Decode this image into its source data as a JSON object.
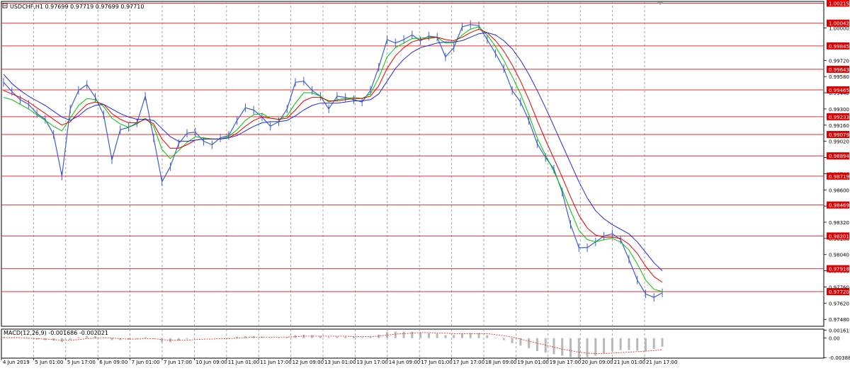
{
  "window": {
    "title": "USDCHF,H1  0.97699 0.97719 0.97699 0.97710",
    "symbol": "USDCHF",
    "timeframe": "H1",
    "ohlc": [
      0.97699,
      0.97719,
      0.97699,
      0.9771
    ]
  },
  "colors": {
    "background": "#ffffff",
    "price_line": "#3a5fcd",
    "ma_fast": "#00c000",
    "ma_mid": "#e00000",
    "ma_slow": "#1f2bd8",
    "level_line": "#e03030",
    "level_label_bg": "#e00000",
    "level_label_text": "#ffffff",
    "grid": "#8f8f8f",
    "axis_text": "#000000",
    "macd_hist": "#b8b8b8",
    "macd_signal": "#e03030"
  },
  "chart_data": [
    {
      "type": "line",
      "subtype": "candlestick-like price chart with moving averages and horizontal levels",
      "ylim": [
        0.9742,
        1.0023
      ],
      "y_ticks": [
        "1.00000",
        "0.99720",
        "0.99580",
        "0.99440",
        "0.99300",
        "0.99160",
        "0.99020",
        "0.98880",
        "0.98740",
        "0.98600",
        "0.98460",
        "0.98320",
        "0.98180",
        "0.98040",
        "0.97900",
        "0.97760",
        "0.97620",
        "0.97480"
      ],
      "levels": [
        "1.00215",
        "1.00042",
        "0.99845",
        "0.99643",
        "0.99465",
        "0.99233",
        "0.99079",
        "0.98894",
        "0.98719",
        "0.98469",
        "0.98201",
        "0.97918",
        "0.97720"
      ],
      "x_tick_labels": [
        "4 Jun 2019",
        "5 Jun 01:00",
        "5 Jun 17:00",
        "6 Jun 09:00",
        "7 Jun 01:00",
        "7 Jun 17:00",
        "10 Jun 09:00",
        "11 Jun 01:00",
        "11 Jun 17:00",
        "12 Jun 09:00",
        "13 Jun 01:00",
        "13 Jun 17:00",
        "14 Jun 09:00",
        "17 Jun 01:00",
        "17 Jun 17:00",
        "18 Jun 09:00",
        "19 Jun 01:00",
        "19 Jun 17:00",
        "20 Jun 09:00",
        "21 Jun 01:00",
        "21 Jun 17:00"
      ],
      "series": [
        {
          "kind": "price",
          "values": [
            0.9953,
            0.9945,
            0.9938,
            0.9934,
            0.9926,
            0.9921,
            0.9908,
            0.9872,
            0.993,
            0.9946,
            0.9951,
            0.994,
            0.9925,
            0.9886,
            0.9912,
            0.9914,
            0.9918,
            0.9941,
            0.9905,
            0.9867,
            0.988,
            0.99,
            0.9909,
            0.991,
            0.9902,
            0.9899,
            0.9905,
            0.9907,
            0.992,
            0.9931,
            0.9929,
            0.9923,
            0.9915,
            0.9919,
            0.993,
            0.9953,
            0.9954,
            0.9946,
            0.9941,
            0.993,
            0.9941,
            0.994,
            0.9938,
            0.9936,
            0.9946,
            0.9966,
            0.999,
            0.9987,
            0.999,
            0.9994,
            0.9989,
            0.9993,
            0.9992,
            0.9975,
            0.9983,
            1.0001,
            1.0003,
            1.0002,
            0.999,
            0.9978,
            0.9965,
            0.9946,
            0.9936,
            0.992,
            0.99,
            0.9888,
            0.9878,
            0.9858,
            0.983,
            0.981,
            0.981,
            0.9815,
            0.982,
            0.9822,
            0.9817,
            0.98,
            0.9782,
            0.977,
            0.9767,
            0.9771
          ]
        },
        {
          "kind": "ma_fast",
          "values": [
            0.994,
            0.9938,
            0.9934,
            0.993,
            0.9925,
            0.992,
            0.9915,
            0.9911,
            0.9922,
            0.9933,
            0.9939,
            0.9938,
            0.9932,
            0.9922,
            0.9917,
            0.9914,
            0.9917,
            0.9922,
            0.9915,
            0.9895,
            0.9887,
            0.9894,
            0.9901,
            0.9906,
            0.9905,
            0.9904,
            0.9904,
            0.9906,
            0.9912,
            0.992,
            0.9925,
            0.9926,
            0.9922,
            0.9921,
            0.9924,
            0.9935,
            0.9944,
            0.9944,
            0.9941,
            0.9936,
            0.9938,
            0.9939,
            0.994,
            0.9939,
            0.9943,
            0.9957,
            0.9975,
            0.9983,
            0.9987,
            0.9991,
            0.9991,
            0.9992,
            0.9992,
            0.9987,
            0.9987,
            0.9994,
            0.9999,
            1.0001,
            0.9994,
            0.9984,
            0.9972,
            0.9958,
            0.9943,
            0.9925,
            0.9905,
            0.989,
            0.9876,
            0.986,
            0.9842,
            0.9825,
            0.9817,
            0.9815,
            0.9817,
            0.9818,
            0.9815,
            0.9808,
            0.9796,
            0.9782,
            0.9774,
            0.9772
          ]
        },
        {
          "kind": "ma_mid",
          "values": [
            0.9946,
            0.9943,
            0.994,
            0.9936,
            0.9931,
            0.9926,
            0.9921,
            0.9916,
            0.9919,
            0.9927,
            0.9934,
            0.9936,
            0.9934,
            0.9926,
            0.9921,
            0.9918,
            0.9918,
            0.9921,
            0.9917,
            0.9904,
            0.9896,
            0.9896,
            0.9899,
            0.9903,
            0.9904,
            0.9904,
            0.9904,
            0.9905,
            0.9909,
            0.9915,
            0.992,
            0.9923,
            0.9922,
            0.9921,
            0.9922,
            0.9929,
            0.9937,
            0.994,
            0.994,
            0.9937,
            0.9937,
            0.9938,
            0.9939,
            0.9939,
            0.9941,
            0.995,
            0.9965,
            0.9976,
            0.9983,
            0.9988,
            0.999,
            0.9991,
            0.9992,
            0.999,
            0.9989,
            0.9992,
            0.9996,
            0.9999,
            0.9996,
            0.9989,
            0.998,
            0.9968,
            0.9954,
            0.9938,
            0.992,
            0.9903,
            0.9887,
            0.9871,
            0.9854,
            0.9838,
            0.9827,
            0.9821,
            0.9819,
            0.9819,
            0.9818,
            0.9813,
            0.9805,
            0.9794,
            0.9785,
            0.978
          ]
        },
        {
          "kind": "ma_slow",
          "values": [
            0.996,
            0.9952,
            0.9946,
            0.9941,
            0.9937,
            0.9933,
            0.9928,
            0.9923,
            0.992,
            0.9924,
            0.993,
            0.9933,
            0.9934,
            0.993,
            0.9926,
            0.9923,
            0.9921,
            0.9921,
            0.992,
            0.9913,
            0.9906,
            0.9902,
            0.9902,
            0.9903,
            0.9904,
            0.9904,
            0.9904,
            0.9905,
            0.9907,
            0.9911,
            0.9915,
            0.9918,
            0.9919,
            0.9919,
            0.992,
            0.9924,
            0.9929,
            0.9933,
            0.9935,
            0.9935,
            0.9935,
            0.9936,
            0.9937,
            0.9937,
            0.9938,
            0.9943,
            0.9954,
            0.9965,
            0.9973,
            0.9979,
            0.9983,
            0.9985,
            0.9987,
            0.9988,
            0.9988,
            0.9989,
            0.9992,
            0.9995,
            0.9996,
            0.9994,
            0.9989,
            0.9982,
            0.9972,
            0.996,
            0.9946,
            0.9931,
            0.9915,
            0.9899,
            0.9883,
            0.9867,
            0.9853,
            0.9842,
            0.9835,
            0.983,
            0.9826,
            0.9822,
            0.9815,
            0.9806,
            0.9797,
            0.979
          ]
        }
      ]
    },
    {
      "type": "bar",
      "title": "MACD(12,26,9) -0.001686 -0.002021",
      "indicator": "MACD",
      "params": [
        12,
        26,
        9
      ],
      "current_values": [
        -0.001686,
        -0.002021
      ],
      "ylim": [
        -0.004,
        0.0018
      ],
      "y_ticks": [
        "0.001615",
        "0.00",
        "-0.003887"
      ],
      "histogram": [
        0.0002,
        0.0001,
        0.0,
        -0.0001,
        -0.0003,
        -0.0004,
        -0.0005,
        -0.0008,
        -0.0003,
        0.0002,
        0.0004,
        0.0004,
        0.0001,
        -0.0004,
        -0.0004,
        -0.0003,
        -0.0002,
        0.0002,
        -0.0001,
        -0.0008,
        -0.0008,
        -0.0005,
        -0.0002,
        0.0,
        0.0,
        0.0,
        0.0,
        0.0001,
        0.0003,
        0.0004,
        0.0004,
        0.0003,
        0.0001,
        0.0001,
        0.0002,
        0.0006,
        0.0007,
        0.0006,
        0.0004,
        0.0002,
        0.0003,
        0.0003,
        0.0003,
        0.0002,
        0.0003,
        0.0007,
        0.0012,
        0.0013,
        0.0013,
        0.0013,
        0.0011,
        0.001,
        0.0009,
        0.0006,
        0.0006,
        0.0009,
        0.001,
        0.001,
        0.0006,
        0.0001,
        -0.0004,
        -0.001,
        -0.0015,
        -0.002,
        -0.0026,
        -0.0029,
        -0.0032,
        -0.0035,
        -0.0038,
        -0.0039,
        -0.0038,
        -0.0035,
        -0.003,
        -0.0026,
        -0.0024,
        -0.0024,
        -0.0025,
        -0.0025,
        -0.0022,
        -0.0017
      ],
      "signal": [
        0.0001,
        0.0001,
        0.0001,
        0.0,
        -0.0001,
        -0.0002,
        -0.0003,
        -0.0004,
        -0.0004,
        -0.0003,
        -0.0001,
        0.0,
        0.0001,
        0.0,
        -0.0001,
        -0.0002,
        -0.0002,
        -0.0001,
        -0.0001,
        -0.0003,
        -0.0004,
        -0.0004,
        -0.0004,
        -0.0003,
        -0.0002,
        -0.0002,
        -0.0001,
        -0.0001,
        0.0,
        0.0001,
        0.0002,
        0.0002,
        0.0002,
        0.0002,
        0.0002,
        0.0003,
        0.0004,
        0.0004,
        0.0004,
        0.0004,
        0.0004,
        0.0004,
        0.0003,
        0.0003,
        0.0003,
        0.0004,
        0.0006,
        0.0008,
        0.0009,
        0.001,
        0.0011,
        0.0011,
        0.001,
        0.001,
        0.0009,
        0.0009,
        0.0009,
        0.0009,
        0.0009,
        0.0007,
        0.0005,
        0.0002,
        -0.0002,
        -0.0006,
        -0.001,
        -0.0014,
        -0.0018,
        -0.0022,
        -0.0025,
        -0.0028,
        -0.003,
        -0.0031,
        -0.0031,
        -0.003,
        -0.0029,
        -0.0028,
        -0.0027,
        -0.0026,
        -0.0025,
        -0.0023
      ]
    }
  ]
}
